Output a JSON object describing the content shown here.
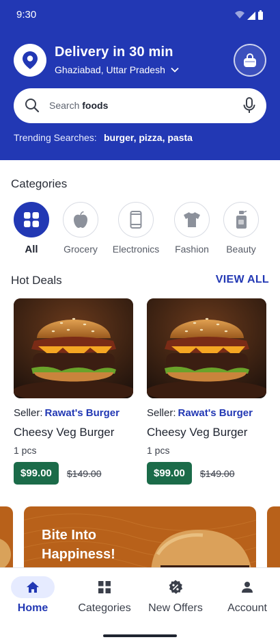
{
  "status_bar": {
    "time": "9:30"
  },
  "header": {
    "delivery_title": "Delivery in 30 min",
    "location": "Ghaziabad, Uttar Pradesh",
    "icons": {
      "location": "location-pin-icon",
      "cart": "shopping-bag-icon"
    }
  },
  "search": {
    "placeholder_prefix": "Search",
    "placeholder_keyword": "foods",
    "trending_label": "Trending Searches:",
    "trending_terms": "burger, pizza, pasta"
  },
  "categories": {
    "title": "Categories",
    "items": [
      {
        "label": "All",
        "icon": "grid-icon",
        "active": true
      },
      {
        "label": "Grocery",
        "icon": "apple-icon",
        "active": false
      },
      {
        "label": "Electronics",
        "icon": "phone-icon",
        "active": false
      },
      {
        "label": "Fashion",
        "icon": "tshirt-icon",
        "active": false
      },
      {
        "label": "Beauty",
        "icon": "cosmetics-bottle-icon",
        "active": false
      }
    ]
  },
  "hot_deals": {
    "title": "Hot Deals",
    "view_all": "VIEW ALL",
    "items": [
      {
        "seller_label": "Seller:",
        "seller": "Rawat's Burger",
        "name": "Cheesy Veg Burger",
        "qty": "1 pcs",
        "price": "$99.00",
        "mrp": "$149.00"
      },
      {
        "seller_label": "Seller:",
        "seller": "Rawat's Burger",
        "name": "Cheesy Veg Burger",
        "qty": "1 pcs",
        "price": "$99.00",
        "mrp": "$149.00"
      }
    ]
  },
  "banner": {
    "text": "Bite Into Happiness!"
  },
  "bottom_nav": {
    "items": [
      {
        "label": "Home",
        "icon": "home-icon",
        "active": true
      },
      {
        "label": "Categories",
        "icon": "grid-icon",
        "active": false
      },
      {
        "label": "New Offers",
        "icon": "discount-badge-icon",
        "active": false
      },
      {
        "label": "Account",
        "icon": "person-icon",
        "active": false
      }
    ]
  },
  "colors": {
    "primary": "#2238b4",
    "price_green": "#1b6b49",
    "banner_orange": "#b8611a",
    "nav_active_bg": "#e6ebff"
  }
}
